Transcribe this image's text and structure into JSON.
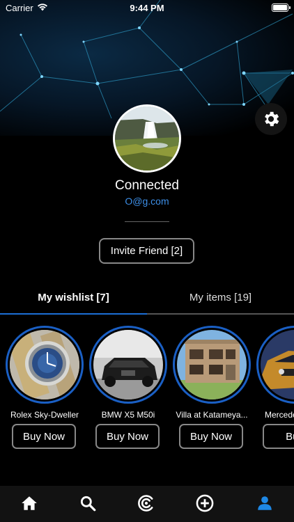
{
  "status_bar": {
    "carrier": "Carrier",
    "time": "9:44 PM"
  },
  "profile": {
    "name": "Connected",
    "email": "O@g.com"
  },
  "invite_button": {
    "label": "Invite Friend [2]"
  },
  "tabs": [
    {
      "label": "My wishlist [7]",
      "active": true
    },
    {
      "label": "My items [19]",
      "active": false
    }
  ],
  "wishlist": [
    {
      "name": "Rolex Sky-Dweller",
      "button": "Buy Now",
      "image": "watch"
    },
    {
      "name": "BMW X5 M50i",
      "button": "Buy Now",
      "image": "suv"
    },
    {
      "name": "Villa at Katameya...",
      "button": "Buy Now",
      "image": "villa"
    },
    {
      "name": "Mercedes",
      "button": "Buy",
      "image": "car"
    }
  ],
  "bottom_nav": [
    {
      "icon": "home-icon",
      "active": false
    },
    {
      "icon": "search-icon",
      "active": false
    },
    {
      "icon": "brand-logo-icon",
      "active": false
    },
    {
      "icon": "add-icon",
      "active": false
    },
    {
      "icon": "profile-icon",
      "active": true
    }
  ],
  "colors": {
    "accent": "#1c6fd6",
    "email": "#3d8fe8",
    "active_nav": "#1e88e5",
    "ring": "#1a5fc4"
  }
}
